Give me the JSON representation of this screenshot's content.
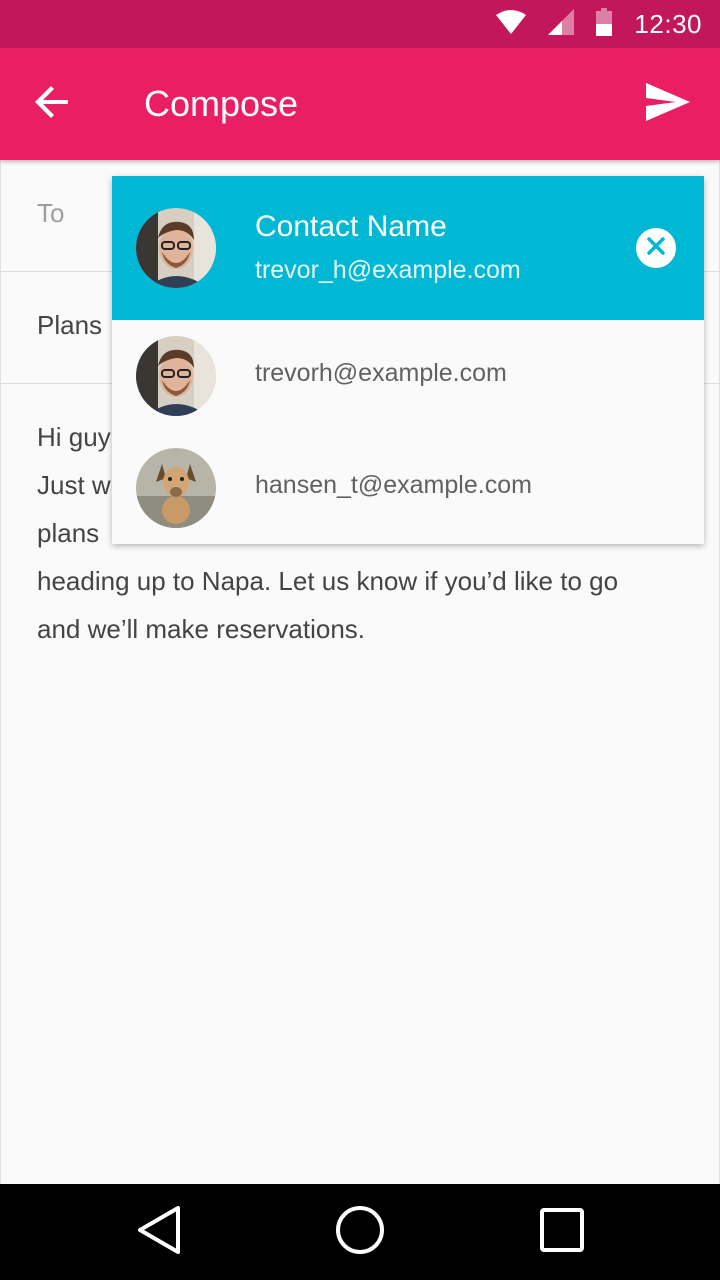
{
  "status_bar": {
    "time": "12:30",
    "icons": [
      "wifi-icon",
      "cell-signal-icon",
      "battery-icon"
    ]
  },
  "app_bar": {
    "title": "Compose",
    "back_icon": "arrow-back-icon",
    "send_icon": "send-icon",
    "color": "#e91e63"
  },
  "compose": {
    "to_label": "To",
    "subject": "Plans",
    "body_lines": [
      "Hi guy",
      "Just w",
      "plans",
      "heading up to Napa. Let us know if you’d like to go",
      "and we’ll make reservations."
    ]
  },
  "suggestions": {
    "selected": {
      "name": "Contact Name",
      "email": "trevor_h@example.com",
      "clear_icon": "close-circle-icon",
      "color": "#00b8d4"
    },
    "items": [
      {
        "email": "trevorh@example.com"
      },
      {
        "email": "hansen_t@example.com"
      }
    ]
  },
  "nav_bar": {
    "icons": [
      "nav-back-icon",
      "nav-home-icon",
      "nav-recents-icon"
    ]
  }
}
